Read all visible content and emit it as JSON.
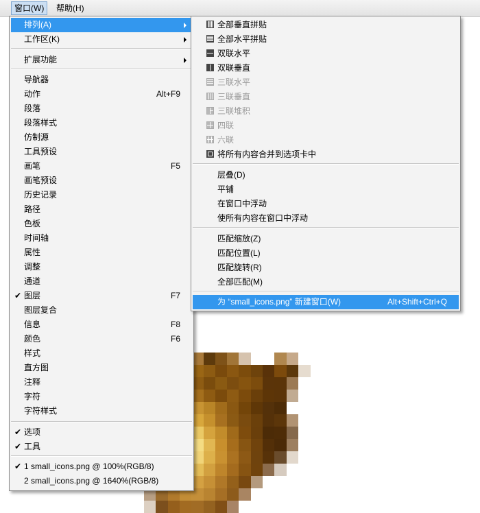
{
  "menubar": {
    "items": [
      "窗口(W)",
      "帮助(H)"
    ]
  },
  "window_menu": {
    "items": [
      {
        "label": "排列(A)",
        "submenu": true,
        "highlight": true
      },
      {
        "label": "工作区(K)",
        "submenu": true
      },
      {
        "sep": true
      },
      {
        "label": "扩展功能",
        "submenu": true
      },
      {
        "sep": true
      },
      {
        "label": "导航器"
      },
      {
        "label": "动作",
        "shortcut": "Alt+F9"
      },
      {
        "label": "段落"
      },
      {
        "label": "段落样式"
      },
      {
        "label": "仿制源"
      },
      {
        "label": "工具预设"
      },
      {
        "label": "画笔",
        "shortcut": "F5"
      },
      {
        "label": "画笔预设"
      },
      {
        "label": "历史记录"
      },
      {
        "label": "路径"
      },
      {
        "label": "色板"
      },
      {
        "label": "时间轴"
      },
      {
        "label": "属性"
      },
      {
        "label": "调整"
      },
      {
        "label": "通道"
      },
      {
        "label": "图层",
        "shortcut": "F7",
        "checked": true
      },
      {
        "label": "图层复合"
      },
      {
        "label": "信息",
        "shortcut": "F8"
      },
      {
        "label": "颜色",
        "shortcut": "F6"
      },
      {
        "label": "样式"
      },
      {
        "label": "直方图"
      },
      {
        "label": "注释"
      },
      {
        "label": "字符"
      },
      {
        "label": "字符样式"
      },
      {
        "sep": true
      },
      {
        "label": "选项",
        "checked": true
      },
      {
        "label": "工具",
        "checked": true
      },
      {
        "sep": true
      },
      {
        "label": "1 small_icons.png @ 100%(RGB/8)",
        "checked": true
      },
      {
        "label": "2 small_icons.png @ 1640%(RGB/8)"
      }
    ]
  },
  "arrange_submenu": {
    "items": [
      {
        "label": "全部垂直拼贴",
        "icon": "tile-vertical-icon"
      },
      {
        "label": "全部水平拼贴",
        "icon": "tile-horizontal-icon"
      },
      {
        "label": "双联水平",
        "icon": "two-up-horizontal-icon"
      },
      {
        "label": "双联垂直",
        "icon": "two-up-vertical-icon"
      },
      {
        "label": "三联水平",
        "icon": "three-up-horizontal-icon",
        "disabled": true
      },
      {
        "label": "三联垂直",
        "icon": "three-up-vertical-icon",
        "disabled": true
      },
      {
        "label": "三联堆积",
        "icon": "three-up-stacked-icon",
        "disabled": true
      },
      {
        "label": "四联",
        "icon": "four-up-icon",
        "disabled": true
      },
      {
        "label": "六联",
        "icon": "six-up-icon",
        "disabled": true
      },
      {
        "label": "将所有内容合并到选项卡中",
        "icon": "consolidate-tabs-icon"
      },
      {
        "sep": true
      },
      {
        "label": "层叠(D)"
      },
      {
        "label": "平铺"
      },
      {
        "label": "在窗口中浮动"
      },
      {
        "label": "使所有内容在窗口中浮动"
      },
      {
        "sep": true
      },
      {
        "label": "匹配缩放(Z)"
      },
      {
        "label": "匹配位置(L)"
      },
      {
        "label": "匹配旋转(R)"
      },
      {
        "label": "全部匹配(M)"
      },
      {
        "sep": true
      },
      {
        "label": "为 “small_icons.png” 新建窗口(W)",
        "shortcut": "Alt+Shift+Ctrl+Q",
        "highlight": true
      }
    ]
  },
  "canvas": {
    "pixel_colors": [
      "#fff",
      "#fff",
      "#fff",
      "#b79a76",
      "#a97a3b",
      "#5d3a0c",
      "#7e5218",
      "#a17538",
      "#d6c3ae",
      "#fff",
      "#fff",
      "#b0874f",
      "#c6a98a",
      "#fff",
      "#fff",
      "#fff",
      "#7f5521",
      "#7a4c0e",
      "#9a6615",
      "#8d5b12",
      "#7a4a0c",
      "#8a5711",
      "#7c4c0c",
      "#6e430c",
      "#593209",
      "#7c4a0c",
      "#5c380b",
      "#e6dccf",
      "#fff",
      "#fff",
      "#8a5a14",
      "#9b6717",
      "#8e5c13",
      "#7a4c0d",
      "#8a5a12",
      "#7c4d0f",
      "#86540f",
      "#7c4c0d",
      "#5b3409",
      "#5b3408",
      "#9c7a54",
      "#fff",
      "#fff",
      "#fff",
      "#a06c1e",
      "#b07a22",
      "#a46f1d",
      "#8e5b12",
      "#7b4b0c",
      "#8e5b13",
      "#7c4b0c",
      "#6a3f0a",
      "#5d3507",
      "#5b3408",
      "#c1ab92",
      "#fff",
      "#fff",
      "#fff",
      "#b9842b",
      "#d8a53a",
      "#c89433",
      "#b98527",
      "#a16c1b",
      "#8a5812",
      "#734509",
      "#5f3707",
      "#54310a",
      "#4d2c07",
      "#fff",
      "#fff",
      "#fff",
      "#fff",
      "#cf9c35",
      "#e3b44c",
      "#d8a73c",
      "#c5902d",
      "#a77020",
      "#8b5a14",
      "#7a4b0f",
      "#6b400b",
      "#553109",
      "#5c360a",
      "#b19373",
      "#fff",
      "#fff",
      "#fff",
      "#e4bd5b",
      "#f3d97e",
      "#ebc965",
      "#d5a33d",
      "#c28c2b",
      "#a06a1a",
      "#7e4c0d",
      "#6a3f0b",
      "#4c2b07",
      "#4e2c07",
      "#85694c",
      "#fff",
      "#fff",
      "#fff",
      "#e8c566",
      "#f9e89a",
      "#f4dc83",
      "#e1b752",
      "#c88f2d",
      "#a66d1c",
      "#875512",
      "#70430c",
      "#532f08",
      "#4b2a07",
      "#9d7f60",
      "#fff",
      "#fff",
      "#fff",
      "#e0b551",
      "#f5d980",
      "#f1d478",
      "#ddb04a",
      "#c99131",
      "#ab7221",
      "#8d5915",
      "#6f430d",
      "#573209",
      "#6a4c2c",
      "#e2d8cc",
      "#fff",
      "#fff",
      "#fff",
      "#d49f3a",
      "#e8c05b",
      "#e4bd58",
      "#d2a03f",
      "#be852b",
      "#a46b1e",
      "#875412",
      "#70430c",
      "#8c6c4d",
      "#d6cbbf",
      "#fff",
      "#fff",
      "#fff",
      "#fff",
      "#c58d2f",
      "#d7a645",
      "#d4a142",
      "#c69036",
      "#b07828",
      "#94601a",
      "#784810",
      "#b49a7e",
      "#fff",
      "#fff",
      "#fff",
      "#fff",
      "#b89f84",
      "#9a6b2c",
      "#b17a2c",
      "#c28d36",
      "#c48f39",
      "#b98431",
      "#a66f25",
      "#8d5b1b",
      "#a98562",
      "#fff",
      "#fff",
      "#fff",
      "#fff",
      "#fff",
      "#ddd0c2",
      "#7c4f1d",
      "#955f1c",
      "#a26b22",
      "#a16c25",
      "#946220",
      "#814f16",
      "#a88466",
      "#fff",
      "#fff",
      "#fff",
      "#fff",
      "#fff",
      "#fff"
    ]
  }
}
